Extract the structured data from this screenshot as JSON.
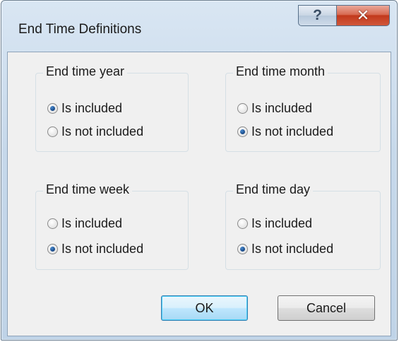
{
  "window": {
    "title": "End Time Definitions",
    "help_glyph": "?",
    "close_glyph": "✕"
  },
  "groups": [
    {
      "label": "End time year",
      "options": [
        "Is included",
        "Is not included"
      ],
      "selected": "Is included"
    },
    {
      "label": "End time month",
      "options": [
        "Is included",
        "Is not included"
      ],
      "selected": "Is not included"
    },
    {
      "label": "End time week",
      "options": [
        "Is included",
        "Is not included"
      ],
      "selected": "Is not included"
    },
    {
      "label": "End time day",
      "options": [
        "Is included",
        "Is not included"
      ],
      "selected": "Is not included"
    }
  ],
  "buttons": {
    "ok_label": "OK",
    "cancel_label": "Cancel"
  }
}
